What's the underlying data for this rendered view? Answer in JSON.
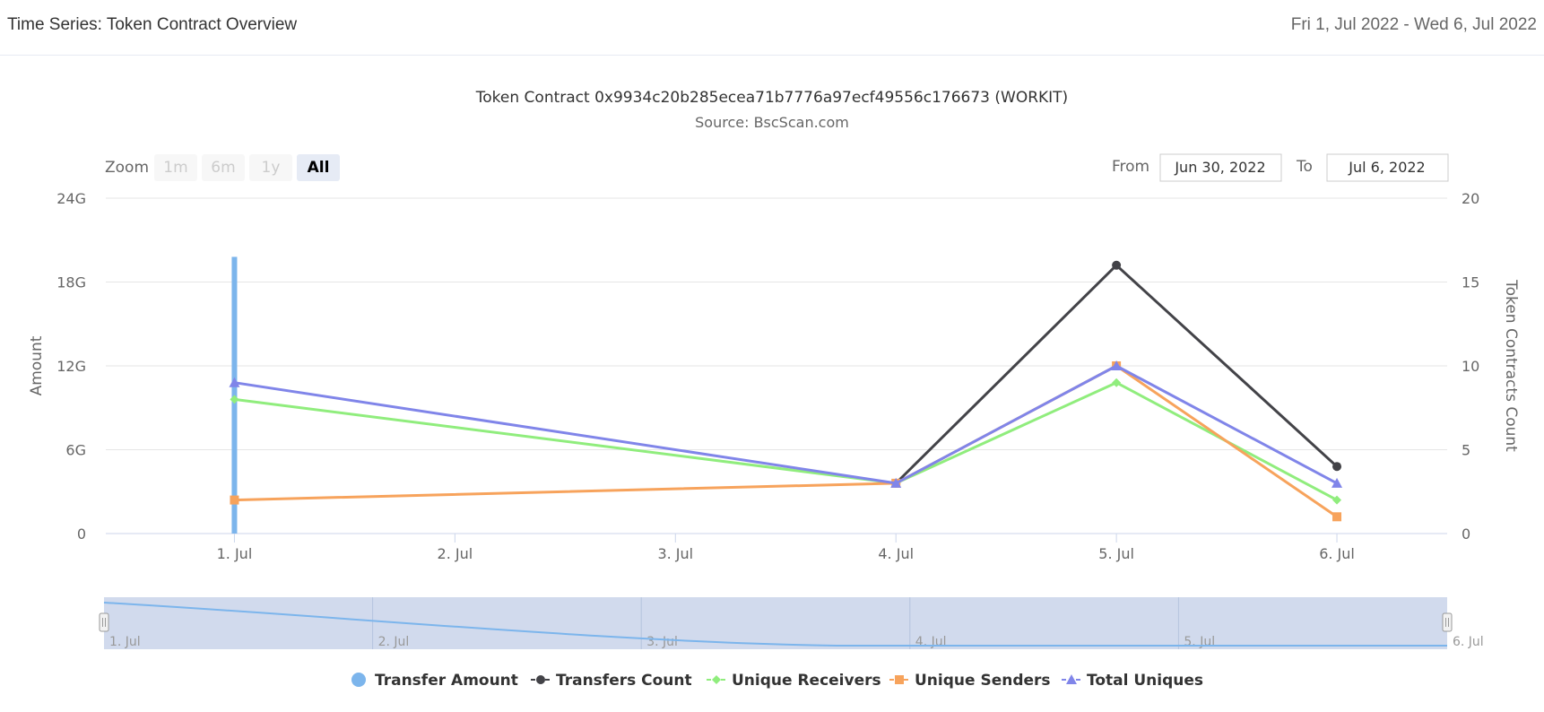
{
  "header": {
    "title": "Time Series: Token Contract Overview",
    "date_range": "Fri 1, Jul 2022 - Wed 6, Jul 2022"
  },
  "range_selector": {
    "zoom_label": "Zoom",
    "buttons": [
      "1m",
      "6m",
      "1y",
      "All"
    ],
    "active_button": "All",
    "from_label": "From",
    "from_value": "Jun 30, 2022",
    "to_label": "To",
    "to_value": "Jul 6, 2022"
  },
  "chart_data": {
    "type": "line",
    "title": "Token Contract 0x9934c20b285ecea71b7776a97ecf49556c176673 (WORKIT)",
    "subtitle": "Source: BscScan.com",
    "x": [
      "2022-07-01",
      "2022-07-04",
      "2022-07-05",
      "2022-07-06"
    ],
    "x_tick_labels": [
      "1. Jul",
      "2. Jul",
      "3. Jul",
      "4. Jul",
      "5. Jul",
      "6. Jul"
    ],
    "x_tick_dates": [
      "2022-07-01",
      "2022-07-02",
      "2022-07-03",
      "2022-07-04",
      "2022-07-05",
      "2022-07-06"
    ],
    "xlim": [
      "2022-06-30T10:00",
      "2022-07-06T12:00"
    ],
    "y_left": {
      "label": "Amount",
      "ticks": [
        "0",
        "6G",
        "12G",
        "18G",
        "24G"
      ],
      "ylim": [
        0,
        24000000000
      ]
    },
    "y_right": {
      "label": "Token Contracts Count",
      "ticks": [
        "0",
        "5",
        "10",
        "15",
        "20"
      ],
      "ylim": [
        0,
        20
      ]
    },
    "series": [
      {
        "name": "Transfer Amount",
        "type": "column",
        "axis": "left",
        "color": "#7cb5ec",
        "marker": "circle",
        "values": [
          19800000000,
          0,
          0,
          0
        ]
      },
      {
        "name": "Transfers Count",
        "type": "line",
        "axis": "right",
        "color": "#434348",
        "marker": "circle",
        "values": [
          null,
          3,
          16,
          4
        ]
      },
      {
        "name": "Unique Receivers",
        "type": "line",
        "axis": "right",
        "color": "#90ed7d",
        "marker": "diamond",
        "values": [
          8,
          3,
          9,
          2
        ]
      },
      {
        "name": "Unique Senders",
        "type": "line",
        "axis": "right",
        "color": "#f7a35c",
        "marker": "square",
        "values": [
          2,
          3,
          10,
          1
        ]
      },
      {
        "name": "Total Uniques",
        "type": "line",
        "axis": "right",
        "color": "#8085e9",
        "marker": "triangle",
        "values": [
          9,
          3,
          10,
          3
        ]
      }
    ],
    "navigator": {
      "tick_labels": [
        "1. Jul",
        "2. Jul",
        "3. Jul",
        "4. Jul",
        "5. Jul",
        "6. Jul"
      ],
      "series_color": "#7cb5ec",
      "fill_color": "#ccd6eb"
    },
    "grid": true,
    "legend_position": "bottom-center"
  }
}
